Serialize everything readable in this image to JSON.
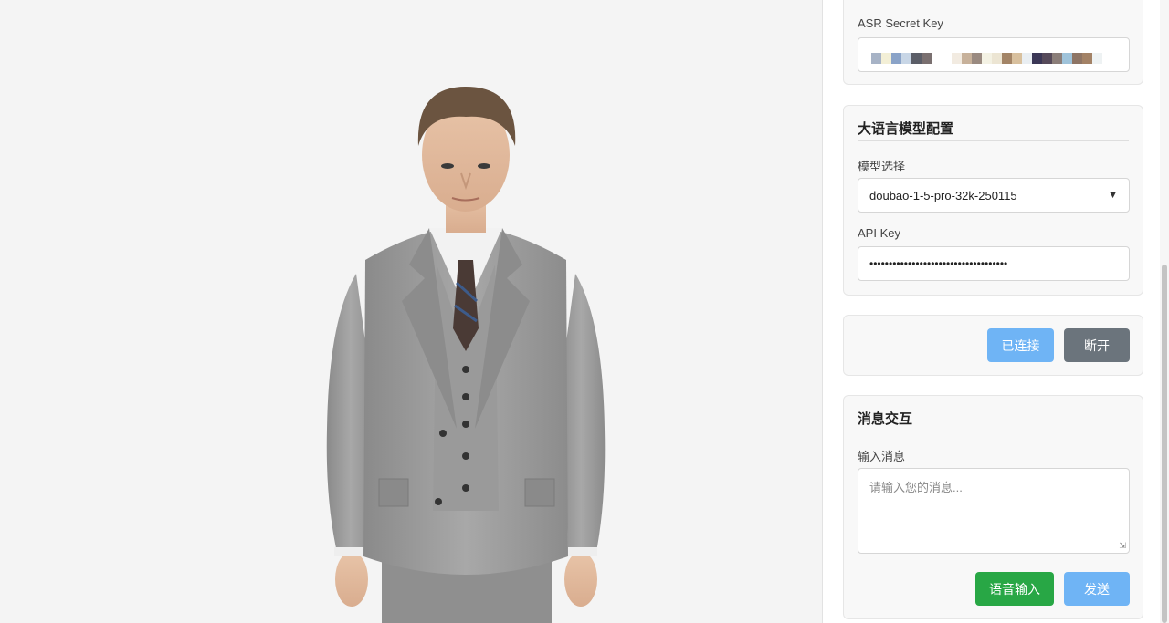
{
  "asr": {
    "secret_key_label": "ASR Secret Key"
  },
  "llm": {
    "title": "大语言模型配置",
    "model_label": "模型选择",
    "model_selected": "doubao-1-5-pro-32k-250115",
    "api_key_label": "API Key",
    "api_key_value": "••••••••••••••••••••••••••••••••••••"
  },
  "connection": {
    "connected_label": "已连接",
    "disconnect_label": "断开"
  },
  "message": {
    "title": "消息交互",
    "input_label": "输入消息",
    "input_placeholder": "请输入您的消息...",
    "voice_input_label": "语音输入",
    "send_label": "发送"
  },
  "colors": {
    "primary_light": "#6fb4f5",
    "secondary": "#6b747c",
    "success": "#28a745"
  },
  "icons": {
    "select_chevron": "chevron-down-icon",
    "textarea_resize": "resize-grip-icon"
  }
}
